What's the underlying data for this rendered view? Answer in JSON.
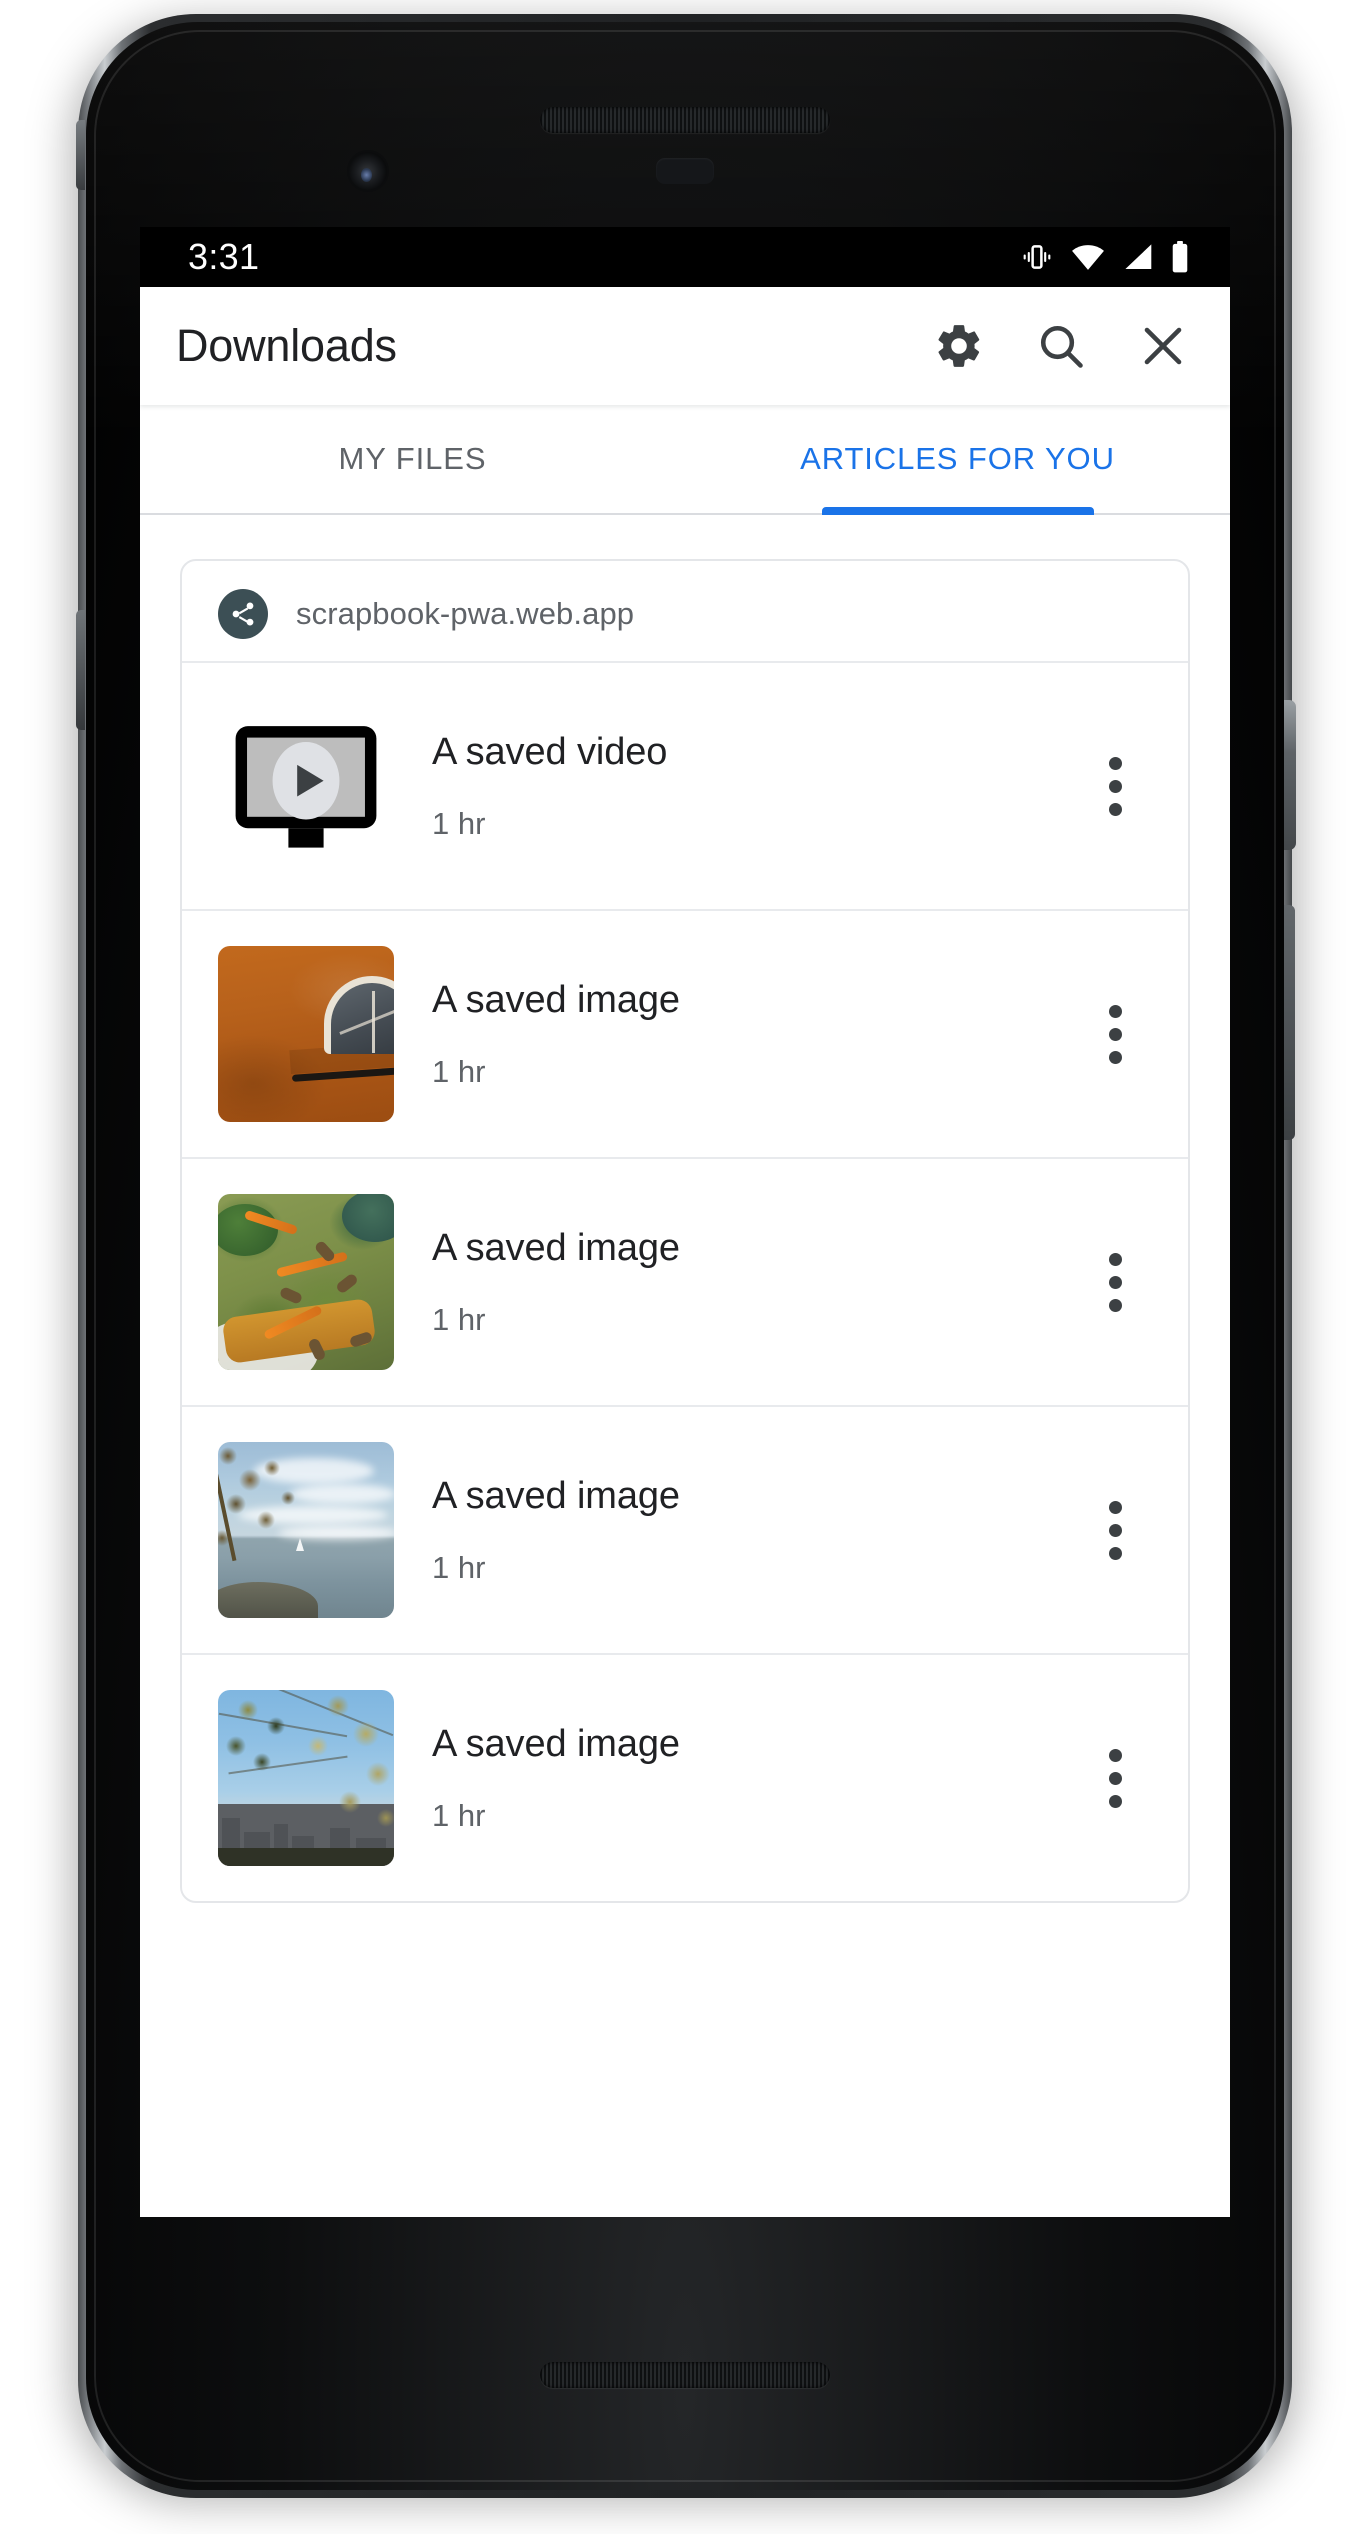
{
  "status_bar": {
    "time": "3:31",
    "icons": [
      "vibrate-icon",
      "wifi-icon",
      "cell-signal-icon",
      "battery-icon"
    ]
  },
  "app_bar": {
    "title": "Downloads",
    "actions": [
      {
        "name": "settings-button",
        "icon": "gear-icon"
      },
      {
        "name": "search-button",
        "icon": "search-icon"
      },
      {
        "name": "close-button",
        "icon": "close-icon"
      }
    ]
  },
  "tabs": [
    {
      "label": "MY FILES",
      "active": false
    },
    {
      "label": "ARTICLES FOR YOU",
      "active": true
    }
  ],
  "accent_color": "#1a73e8",
  "card": {
    "origin": {
      "icon": "share-icon",
      "url": "scrapbook-pwa.web.app",
      "badge_color": "#3c4f55"
    },
    "items": [
      {
        "title": "A saved video",
        "subtitle": "1 hr",
        "thumb_type": "video-placeholder-icon",
        "menu": "overflow-menu-icon"
      },
      {
        "title": "A saved image",
        "subtitle": "1 hr",
        "thumb_type": "orange-wall-photo",
        "menu": "overflow-menu-icon"
      },
      {
        "title": "A saved image",
        "subtitle": "1 hr",
        "thumb_type": "avocado-toast-photo",
        "menu": "overflow-menu-icon"
      },
      {
        "title": "A saved image",
        "subtitle": "1 hr",
        "thumb_type": "lake-sailboat-photo",
        "menu": "overflow-menu-icon"
      },
      {
        "title": "A saved image",
        "subtitle": "1 hr",
        "thumb_type": "city-skyline-photo",
        "menu": "overflow-menu-icon"
      }
    ]
  }
}
